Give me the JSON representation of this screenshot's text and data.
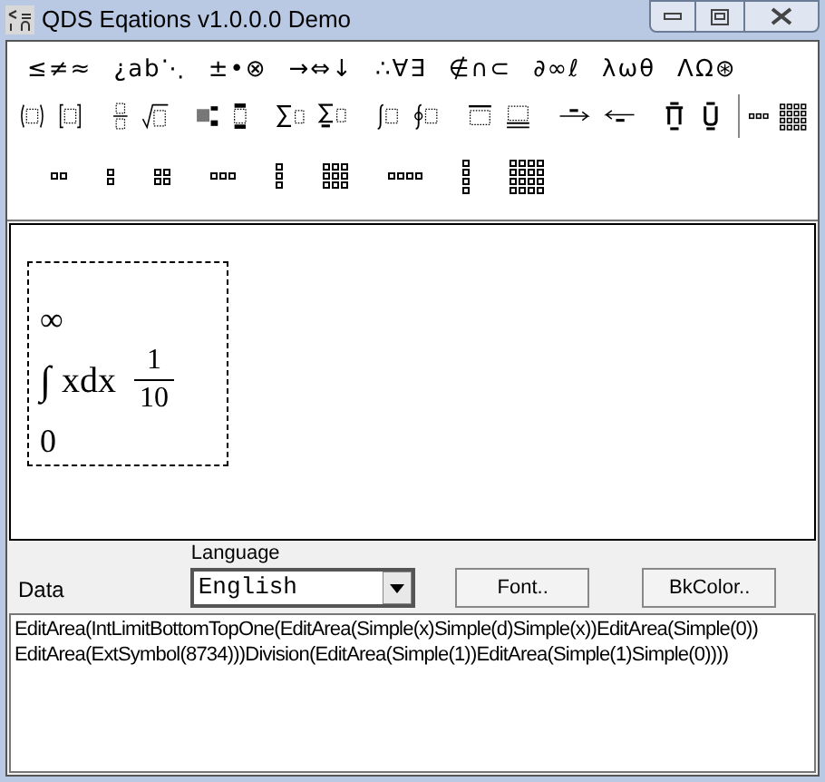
{
  "window": {
    "title": "QDS Eqations v1.0.0.0 Demo"
  },
  "symbol_groups": [
    "≤≠≈",
    "¿ab⋱",
    "±•⊗",
    "→⇔↓",
    "∴∀∃",
    "∉∩⊂",
    "∂∞ℓ",
    "λωθ",
    "ΛΩ⊛"
  ],
  "equation": {
    "upper": "∞",
    "integral": "∫",
    "integrand": "xdx",
    "numerator": "1",
    "denominator": "10",
    "lower": "0"
  },
  "data_label": "Data",
  "language": {
    "label": "Language",
    "value": "English"
  },
  "buttons": [
    "Font..",
    "BkColor.."
  ],
  "data_text": [
    "EditArea(IntLimitBottomTopOne(EditArea(Simple(x)Simple(d)Simple(x))EditArea(Simple(0))",
    "EditArea(ExtSymbol(8734)))Division(EditArea(Simple(1))EditArea(Simple(1)Simple(0))))"
  ]
}
